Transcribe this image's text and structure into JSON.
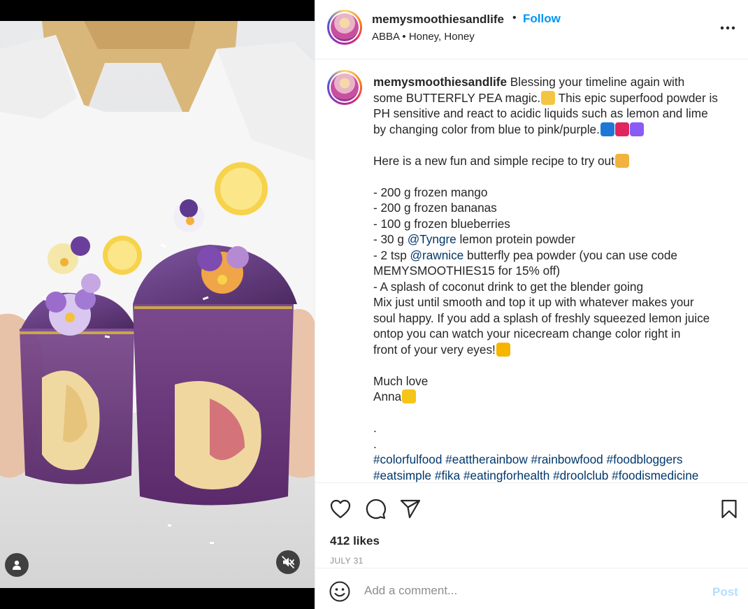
{
  "post": {
    "username": "memysmoothiesandlife",
    "separator": "•",
    "follow_label": "Follow",
    "audio_artist": "ABBA",
    "audio_separator": "•",
    "audio_title": "Honey, Honey",
    "more_icon": "more-horizontal-icon"
  },
  "caption": {
    "author": "memysmoothiesandlife",
    "lines": [
      {
        "parts": [
          {
            "text": " Blessing your timeline again with"
          }
        ]
      },
      {
        "parts": [
          {
            "text": "some BUTTERFLY PEA magic."
          },
          {
            "emoji": "#f4c542"
          },
          {
            "text": " This epic superfood powder is"
          }
        ]
      },
      {
        "parts": [
          {
            "text": "PH sensitive and react to acidic liquids such as lemon and lime"
          }
        ]
      },
      {
        "parts": [
          {
            "text": "by changing color from blue to pink/purple."
          },
          {
            "emoji": "#1e77d6"
          },
          {
            "emoji": "#e0245e"
          },
          {
            "emoji": "#8a5cf5"
          }
        ]
      },
      {
        "parts": [
          {
            "text": ""
          }
        ]
      },
      {
        "parts": [
          {
            "text": "Here is a new fun and simple recipe to try out"
          },
          {
            "emoji": "#f2b33d"
          }
        ]
      },
      {
        "parts": [
          {
            "text": ""
          }
        ]
      },
      {
        "parts": [
          {
            "text": "- 200 g frozen mango"
          }
        ]
      },
      {
        "parts": [
          {
            "text": "- 200 g frozen bananas"
          }
        ]
      },
      {
        "parts": [
          {
            "text": "- 100 g frozen blueberries"
          }
        ]
      },
      {
        "parts": [
          {
            "text": "- 30 g "
          },
          {
            "mention": "@Tyngre"
          },
          {
            "text": " lemon protein powder"
          }
        ]
      },
      {
        "parts": [
          {
            "text": "- 2 tsp "
          },
          {
            "mention": "@rawnice"
          },
          {
            "text": " butterfly pea powder (you can use code"
          }
        ]
      },
      {
        "parts": [
          {
            "text": "MEMYSMOOTHIES15 for 15% off)"
          }
        ]
      },
      {
        "parts": [
          {
            "text": "- A splash of coconut drink to get the blender going"
          }
        ]
      },
      {
        "parts": [
          {
            "text": "Mix just until smooth and top it up with whatever makes your"
          }
        ]
      },
      {
        "parts": [
          {
            "text": "soul happy. If you add a splash of freshly squeezed lemon juice"
          }
        ]
      },
      {
        "parts": [
          {
            "text": "ontop you can watch your nicecream change color right in"
          }
        ]
      },
      {
        "parts": [
          {
            "text": "front of your very eyes!"
          },
          {
            "emoji": "#f7b500"
          }
        ]
      },
      {
        "parts": [
          {
            "text": ""
          }
        ]
      },
      {
        "parts": [
          {
            "text": "Much love"
          }
        ]
      },
      {
        "parts": [
          {
            "text": "Anna"
          },
          {
            "emoji": "#f5c518"
          }
        ]
      },
      {
        "parts": [
          {
            "text": ""
          }
        ]
      },
      {
        "parts": [
          {
            "text": "."
          }
        ]
      },
      {
        "parts": [
          {
            "text": "."
          }
        ]
      },
      {
        "parts": [
          {
            "hashtag": "#colorfulfood"
          },
          {
            "text": " "
          },
          {
            "hashtag": "#eattherainbow"
          },
          {
            "text": " "
          },
          {
            "hashtag": "#rainbowfood"
          },
          {
            "text": " "
          },
          {
            "hashtag": "#foodbloggers"
          }
        ]
      },
      {
        "parts": [
          {
            "hashtag": "#eatsimple"
          },
          {
            "text": " "
          },
          {
            "hashtag": "#fika"
          },
          {
            "text": " "
          },
          {
            "hashtag": "#eatingforhealth"
          },
          {
            "text": " "
          },
          {
            "hashtag": "#droolclub"
          },
          {
            "text": " "
          },
          {
            "hashtag": "#foodismedicine"
          }
        ]
      }
    ]
  },
  "actions": {
    "like_icon": "heart-icon",
    "comment_icon": "comment-icon",
    "share_icon": "share-icon",
    "save_icon": "bookmark-icon",
    "likes_text": "412 likes",
    "date_text": "JULY 31"
  },
  "comment": {
    "emoji_icon": "emoji-icon",
    "placeholder": "Add a comment...",
    "post_label": "Post"
  },
  "media": {
    "user_tag_icon": "user-tag-icon",
    "mute_icon": "muted-speaker-icon"
  },
  "colors": {
    "follow": "#0095f6",
    "link": "#00376b",
    "post_disabled": "#b2dffc",
    "muted_text": "#8e8e8e"
  }
}
